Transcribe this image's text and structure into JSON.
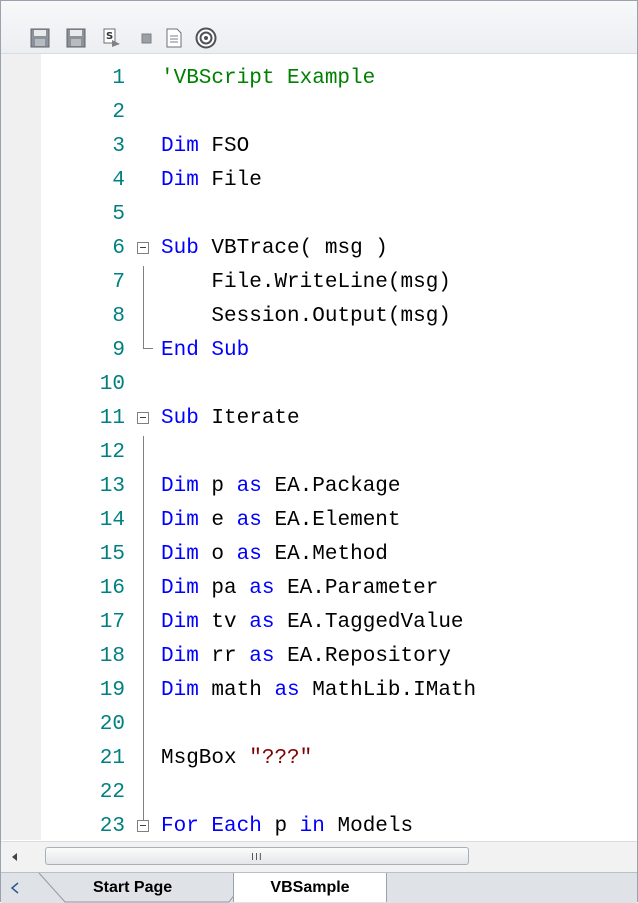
{
  "toolbar": {
    "buttons": [
      {
        "name": "save-icon",
        "label": "Save"
      },
      {
        "name": "save-as-icon",
        "label": "Save As"
      },
      {
        "name": "run-script-icon",
        "label": "Run Script"
      },
      {
        "name": "stop-icon",
        "label": "Stop"
      },
      {
        "name": "document-icon",
        "label": "Document"
      },
      {
        "name": "help-icon",
        "label": "Help"
      }
    ]
  },
  "editor": {
    "language": "VBScript",
    "lines": [
      {
        "n": "1",
        "text": "'VBScript Example"
      },
      {
        "n": "2",
        "text": ""
      },
      {
        "n": "3",
        "text": "Dim FSO"
      },
      {
        "n": "4",
        "text": "Dim File"
      },
      {
        "n": "5",
        "text": ""
      },
      {
        "n": "6",
        "text": "Sub VBTrace( msg )"
      },
      {
        "n": "7",
        "text": "    File.WriteLine(msg)"
      },
      {
        "n": "8",
        "text": "    Session.Output(msg)"
      },
      {
        "n": "9",
        "text": "End Sub"
      },
      {
        "n": "10",
        "text": ""
      },
      {
        "n": "11",
        "text": "Sub Iterate"
      },
      {
        "n": "12",
        "text": ""
      },
      {
        "n": "13",
        "text": "Dim p as EA.Package"
      },
      {
        "n": "14",
        "text": "Dim e as EA.Element"
      },
      {
        "n": "15",
        "text": "Dim o as EA.Method"
      },
      {
        "n": "16",
        "text": "Dim pa as EA.Parameter"
      },
      {
        "n": "17",
        "text": "Dim tv as EA.TaggedValue"
      },
      {
        "n": "18",
        "text": "Dim rr as EA.Repository"
      },
      {
        "n": "19",
        "text": "Dim math as MathLib.IMath"
      },
      {
        "n": "20",
        "text": ""
      },
      {
        "n": "21",
        "text": "MsgBox \"???\""
      },
      {
        "n": "22",
        "text": ""
      },
      {
        "n": "23",
        "text": "For Each p in Models"
      }
    ]
  },
  "scrollbar": {
    "grip": "III"
  },
  "tabs": [
    {
      "label": "Start Page",
      "active": false
    },
    {
      "label": "VBSample",
      "active": true
    }
  ],
  "colors": {
    "keyword": "#0000ff",
    "comment": "#008000",
    "string": "#800000",
    "line_number": "#008080"
  }
}
